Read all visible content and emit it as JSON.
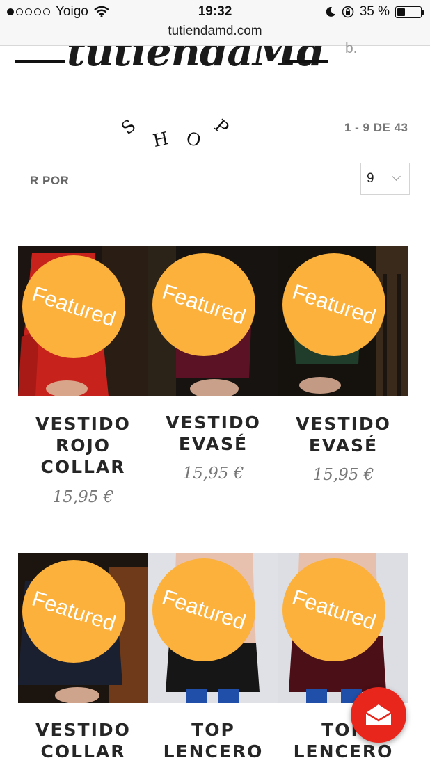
{
  "status_bar": {
    "carrier": "Yoigo",
    "time": "19:32",
    "battery_percent": "35 %",
    "battery_level": 0.35,
    "signal_bars_filled": 1,
    "signal_bars_total": 5,
    "icons": [
      "wifi-icon",
      "moon-icon",
      "orientation-lock-icon",
      "battery-icon"
    ]
  },
  "browser": {
    "url": "tutiendamd.com"
  },
  "logo": {
    "wordmark": "tutiendaMd",
    "tagline_letters": [
      "S",
      "H",
      "O",
      "P"
    ]
  },
  "faded_text": "b.",
  "toolbar": {
    "results_count": "1 - 9 DE 43",
    "sort_label": "R POR",
    "per_page_value": "9"
  },
  "badge_label": "Featured",
  "colors": {
    "badge": "#fbb13c",
    "fab": "#e8261c"
  },
  "products": [
    {
      "name": "VESTIDO ROJO COLLAR",
      "price": "15,95 €"
    },
    {
      "name": "VESTIDO EVASÉ",
      "price": "15,95 €"
    },
    {
      "name": "VESTIDO EVASÉ",
      "price": "15,95 €"
    },
    {
      "name": "VESTIDO COLLAR",
      "price": ""
    },
    {
      "name": "TOP LENCERO",
      "price": ""
    },
    {
      "name": "TOP LENCERO",
      "price": ""
    }
  ],
  "fab": {
    "icon": "envelope-icon"
  }
}
